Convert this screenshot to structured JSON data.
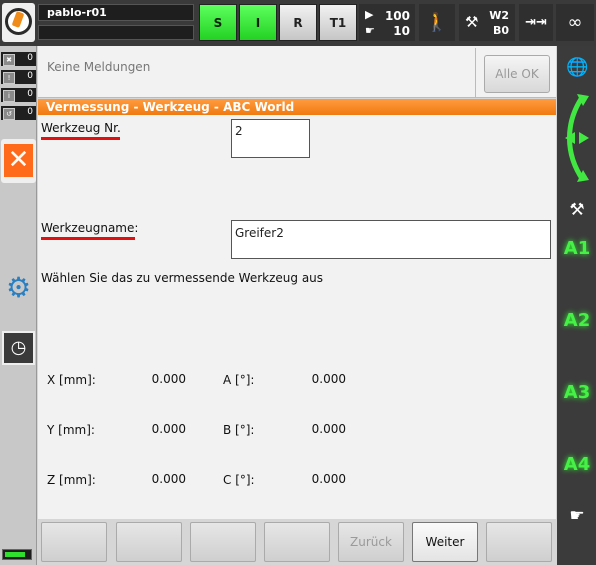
{
  "header": {
    "robot_name": "pablo-r01",
    "states": [
      "S",
      "I",
      "R",
      "T1"
    ],
    "override": {
      "program": "100",
      "jog": "10"
    },
    "tool": {
      "w": "W2",
      "b": "B0"
    },
    "step_mode": "⇥⇥",
    "infinite": "∞"
  },
  "left": {
    "message_counts": [
      "0",
      "0",
      "0",
      "0"
    ],
    "close_symbol": "✕",
    "gear_symbol": "⚙",
    "clock_symbol": "◷",
    "battery_level": 0.85
  },
  "right": {
    "axes": [
      "A1",
      "A2",
      "A3",
      "A4"
    ]
  },
  "messages": {
    "text": "Keine Meldungen",
    "ack_all_label": "Alle OK"
  },
  "panel": {
    "title": "Vermessung - Werkzeug - ABC World",
    "tool_no_label": "Werkzeug Nr.",
    "tool_no_value": "2",
    "tool_name_label": "Werkzeugname:",
    "tool_name_value": "Greifer2",
    "hint": "Wählen Sie das zu vermessende Werkzeug aus",
    "coords": [
      {
        "label": "X [mm]:",
        "value": "0.000",
        "label2": "A [°]:",
        "value2": "0.000"
      },
      {
        "label": "Y [mm]:",
        "value": "0.000",
        "label2": "B [°]:",
        "value2": "0.000"
      },
      {
        "label": "Z [mm]:",
        "value": "0.000",
        "label2": "C [°]:",
        "value2": "0.000"
      }
    ]
  },
  "softkeys": {
    "back": "Zurück",
    "next": "Weiter"
  },
  "colors": {
    "accent": "#f07a10",
    "green_active": "#24d124",
    "axis_green": "#46f046"
  }
}
